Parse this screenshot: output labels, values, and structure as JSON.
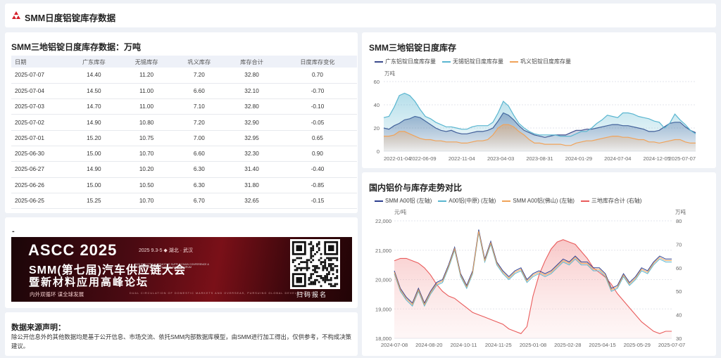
{
  "header": {
    "title": "SMM日度铝锭库存数据"
  },
  "inventory_table": {
    "title": "SMM三地铝锭日度库存数据：万吨",
    "columns": [
      "日期",
      "广东库存",
      "无锡库存",
      "巩义库存",
      "库存合计",
      "日度库存变化"
    ],
    "rows": [
      [
        "2025-07-07",
        "14.40",
        "11.20",
        "7.20",
        "32.80",
        "0.70"
      ],
      [
        "2025-07-04",
        "14.50",
        "11.00",
        "6.60",
        "32.10",
        "-0.70"
      ],
      [
        "2025-07-03",
        "14.70",
        "11.00",
        "7.10",
        "32.80",
        "-0.10"
      ],
      [
        "2025-07-02",
        "14.90",
        "10.80",
        "7.20",
        "32.90",
        "-0.05"
      ],
      [
        "2025-07-01",
        "15.20",
        "10.75",
        "7.00",
        "32.95",
        "0.65"
      ],
      [
        "2025-06-30",
        "15.00",
        "10.70",
        "6.60",
        "32.30",
        "0.90"
      ],
      [
        "2025-06-27",
        "14.90",
        "10.20",
        "6.30",
        "31.40",
        "-0.40"
      ],
      [
        "2025-06-26",
        "15.00",
        "10.50",
        "6.30",
        "31.80",
        "-0.85"
      ],
      [
        "2025-06-25",
        "15.25",
        "10.70",
        "6.70",
        "32.65",
        "-0.15"
      ]
    ]
  },
  "banner": {
    "section_marker": "-",
    "brand": "ASCC 2025",
    "date_place": "2025 9.3-5 ◆ 湖北 · 武汉",
    "line1": "SMM(第七届)汽车供应链大会",
    "line1_en": "2025 SMM (7TH) AUTOMOTIVE SUPPLY CHAIN CONFERENCE & NEW MATERIALS APPLICATION SUMMIT FORUM",
    "line2": "暨新材料应用高峰论坛",
    "tagline": "内外双循环  谋全球发展",
    "tagline_en": "DUAL CIRCULATION OF DOMESTIC MARKETS AND OVERSEAS, PURSUING GLOBAL DEVELOPMENT",
    "qr_label": "扫码报名"
  },
  "source_note": {
    "title": "数据来源声明：",
    "text": "除公开信息外的其他数据均是基于公开信息、市场交流、依托SMM内部数据库模型，由SMM进行加工得出，仅供参考，不构成决策建议。"
  },
  "chart_data": [
    {
      "type": "area",
      "title": "SMM三地铝锭日度库存",
      "unit_label": "万吨",
      "ylim": [
        0,
        60
      ],
      "yticks": [
        "0",
        "20",
        "40",
        "60"
      ],
      "xtick_labels": [
        "2022-01-04",
        "2022-06-09",
        "2022-11-04",
        "2023-04-03",
        "2023-08-31",
        "2024-01-29",
        "2024-07-04",
        "2024-12-05",
        "2025-07-07"
      ],
      "grid": true,
      "legend_position": "top-left",
      "series": [
        {
          "name": "广东铝锭日度库存量",
          "color": "#3b4a8c",
          "values": [
            20,
            19,
            22,
            24,
            27,
            28,
            30,
            29,
            26,
            23,
            20,
            18,
            17,
            18,
            16,
            15,
            15,
            16,
            17,
            17,
            18,
            20,
            26,
            33,
            31,
            27,
            22,
            18,
            16,
            14,
            13,
            12,
            13,
            14,
            14,
            14,
            16,
            18,
            18,
            19,
            19,
            20,
            21,
            22,
            23,
            23,
            22,
            22,
            21,
            20,
            19,
            17,
            17,
            18,
            21,
            24,
            25,
            25,
            21,
            18,
            16
          ]
        },
        {
          "name": "无锡铝锭日度库存量",
          "color": "#5ab6d0",
          "values": [
            29,
            30,
            38,
            48,
            50,
            48,
            43,
            36,
            30,
            28,
            25,
            23,
            21,
            21,
            20,
            19,
            19,
            21,
            22,
            22,
            22,
            25,
            33,
            43,
            39,
            31,
            24,
            20,
            17,
            15,
            14,
            14,
            14,
            14,
            13,
            13,
            13,
            15,
            17,
            17,
            20,
            24,
            27,
            31,
            30,
            29,
            33,
            33,
            32,
            30,
            29,
            28,
            26,
            25,
            20,
            24,
            32,
            27,
            23,
            18,
            15
          ]
        },
        {
          "name": "巩义铝锭日度库存量",
          "color": "#f0a35a",
          "values": [
            13,
            13,
            14,
            17,
            17,
            15,
            13,
            11,
            10,
            10,
            9,
            9,
            8,
            8,
            8,
            7,
            7,
            8,
            9,
            9,
            10,
            14,
            20,
            23,
            23,
            21,
            17,
            14,
            10,
            7,
            7,
            6,
            6,
            6,
            6,
            5,
            5,
            7,
            8,
            9,
            9,
            10,
            11,
            12,
            13,
            13,
            12,
            12,
            11,
            10,
            10,
            8,
            8,
            7,
            8,
            9,
            10,
            10,
            8,
            7,
            7
          ]
        }
      ]
    },
    {
      "type": "line",
      "title": "国内铝价与库存走势对比",
      "left_unit": "元/吨",
      "right_unit": "万吨",
      "ylim_left": [
        18000,
        22000
      ],
      "ylim_right": [
        30,
        80
      ],
      "yticks_left": [
        "18,000",
        "19,000",
        "20,000",
        "21,000",
        "22,000"
      ],
      "yticks_right": [
        "30",
        "40",
        "50",
        "60",
        "70",
        "80"
      ],
      "xtick_labels": [
        "2024-07-08",
        "2024-08-20",
        "2024-10-11",
        "2024-11-25",
        "2025-01-08",
        "2025-02-28",
        "2025-04-15",
        "2025-05-29",
        "2025-07-07"
      ],
      "grid": true,
      "legend_position": "top-left",
      "series": [
        {
          "name": "SMM A00铝 (左轴)",
          "color": "#2c3e8f",
          "axis": "left",
          "values": [
            20300,
            19700,
            19400,
            19200,
            19700,
            19200,
            19600,
            19900,
            20000,
            20500,
            21100,
            20200,
            19800,
            20300,
            21700,
            20700,
            21300,
            20600,
            20300,
            20100,
            20300,
            20400,
            20000,
            20200,
            20300,
            20200,
            20300,
            20500,
            20700,
            20600,
            20800,
            20600,
            20600,
            20400,
            20400,
            20200,
            19700,
            19800,
            20200,
            19900,
            20100,
            20400,
            20300,
            20600,
            20800,
            20700,
            20700
          ]
        },
        {
          "name": "A00铝(中原) (左轴)",
          "color": "#5ab6d0",
          "axis": "left",
          "values": [
            20200,
            19600,
            19300,
            19100,
            19600,
            19100,
            19500,
            19800,
            19900,
            20400,
            21000,
            20100,
            19700,
            20200,
            21600,
            20600,
            21200,
            20500,
            20200,
            20000,
            20200,
            20300,
            19900,
            20100,
            20200,
            20100,
            20200,
            20400,
            20600,
            20500,
            20700,
            20500,
            20500,
            20300,
            20300,
            20100,
            19600,
            19700,
            20100,
            19800,
            20000,
            20300,
            20200,
            20500,
            20700,
            20600,
            20600
          ]
        },
        {
          "name": "SMM A00铝(佛山) (左轴)",
          "color": "#f0a35a",
          "axis": "left",
          "values": [
            20250,
            19650,
            19350,
            19150,
            19650,
            19150,
            19550,
            19850,
            19950,
            20450,
            21050,
            20150,
            19750,
            20250,
            21650,
            20650,
            21250,
            20550,
            20250,
            20050,
            20250,
            20350,
            19950,
            20150,
            20250,
            20150,
            20250,
            20450,
            20650,
            20550,
            20750,
            20550,
            20550,
            20350,
            20350,
            20150,
            19650,
            19750,
            20150,
            19850,
            20050,
            20350,
            20250,
            20550,
            20750,
            20650,
            20650
          ]
        },
        {
          "name": "三地库存合计 (右轴)",
          "color": "#e95b5b",
          "axis": "right",
          "values": [
            63,
            64,
            64,
            63,
            62,
            60,
            57,
            53,
            50,
            48,
            47,
            45,
            43,
            41,
            40,
            39,
            38,
            37,
            36,
            34,
            33,
            32,
            35,
            48,
            57,
            63,
            68,
            71,
            72,
            71,
            70,
            67,
            64,
            60,
            58,
            56,
            53,
            49,
            46,
            43,
            40,
            37,
            35,
            33,
            32,
            33,
            33
          ]
        }
      ]
    }
  ]
}
